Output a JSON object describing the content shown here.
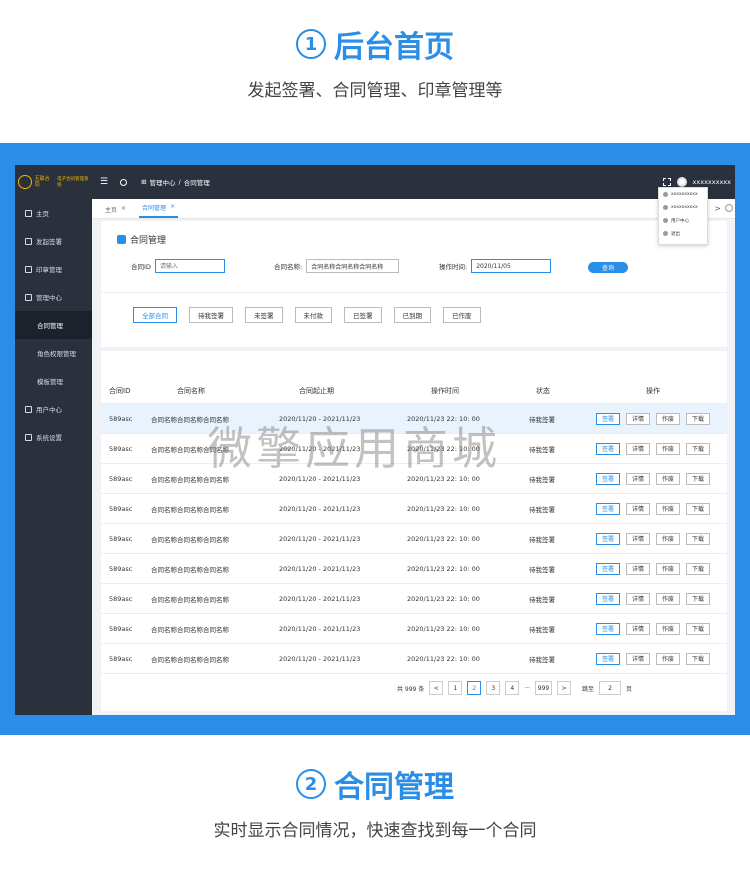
{
  "section1": {
    "num": "1",
    "title": "后台首页",
    "subtitle": "发起签署、合同管理、印章管理等"
  },
  "section2": {
    "num": "2",
    "title": "合同管理",
    "subtitle": "实时显示合同情况，快速查找到每一个合同"
  },
  "watermark": "微擎应用商城",
  "app": {
    "logo": {
      "brand": "互联合同",
      "system": "电子合同管理系统"
    },
    "sidebar": [
      {
        "label": "主页"
      },
      {
        "label": "发起签署"
      },
      {
        "label": "印章管理"
      },
      {
        "label": "管理中心"
      },
      {
        "label": "合同管理"
      },
      {
        "label": "角色权限管理"
      },
      {
        "label": "模板管理"
      },
      {
        "label": "用户中心"
      },
      {
        "label": "系统设置"
      }
    ],
    "topbar": {
      "crumb_root": "管理中心",
      "crumb_sep": "/",
      "crumb_current": "合同管理",
      "username": "xxxxxxxxxx"
    },
    "dropdown": [
      "xxxxxxxxxx",
      "xxxxxxxxxx",
      "用户中心",
      "退出"
    ],
    "tabs": [
      {
        "label": "主页",
        "close": "×"
      },
      {
        "label": "合同管理",
        "close": "×"
      }
    ],
    "tab_arrow": ">",
    "panel_title": "合同管理",
    "form": {
      "id_label": "合同ID",
      "id_placeholder": "请输入",
      "name_label": "合同名称:",
      "name_value": "合同名称合同名称合同名称",
      "time_label": "操作时间:",
      "time_value": "2020/11/05",
      "query": "查询"
    },
    "filters": [
      "全部合同",
      "待我签署",
      "未签署",
      "未付款",
      "已签署",
      "已到期",
      "已作废"
    ],
    "table": {
      "headers": [
        "合同ID",
        "合同名称",
        "合同起止期",
        "操作时间",
        "状态",
        "操作"
      ],
      "row": {
        "id": "589asc",
        "name": "合同名称合同名称合同名称",
        "period": "2020/11/20 - 2021/11/23",
        "time": "2020/11/23   22: 10: 00",
        "status": "待我签署"
      },
      "row_count": 9,
      "actions": [
        "签署",
        "详情",
        "作废",
        "下载"
      ]
    },
    "pager": {
      "total": "共 999 条",
      "prev": "<",
      "pages": [
        "1",
        "2",
        "3",
        "4"
      ],
      "ellipsis": "···",
      "last": "999",
      "next": ">",
      "goto": "跳至",
      "goto_value": "2",
      "unit": "页"
    }
  }
}
